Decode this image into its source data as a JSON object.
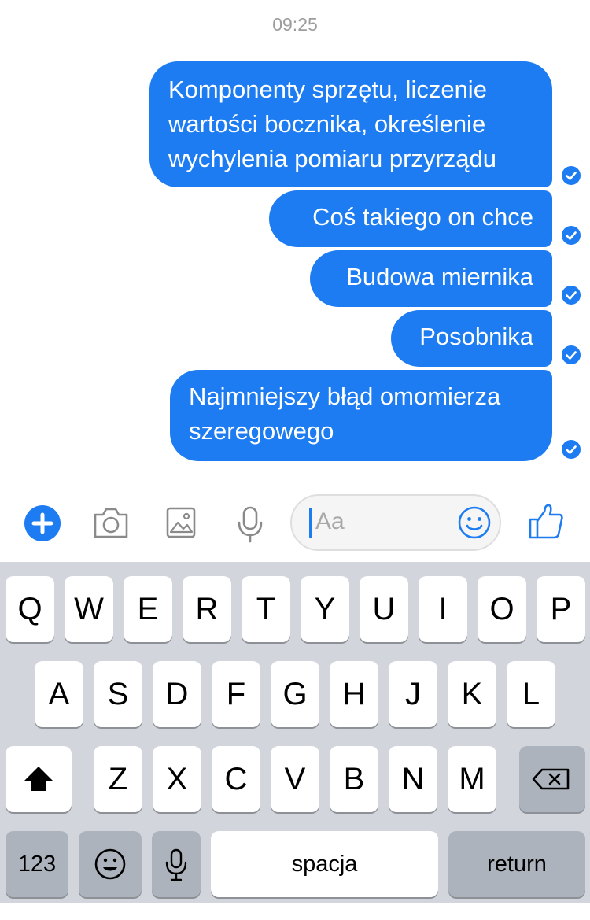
{
  "header": {
    "time": "09:25"
  },
  "messages": [
    {
      "lines": [
        "Komponenty sprzętu, liczenie",
        "wartości bocznika, określenie",
        "wychylenia pomiaru przyrządu"
      ]
    },
    {
      "lines": [
        "Coś takiego on chce"
      ]
    },
    {
      "lines": [
        "Budowa miernika"
      ]
    },
    {
      "lines": [
        "Posobnika"
      ]
    },
    {
      "lines": [
        "Najmniejszy błąd omomierza",
        "szeregowego"
      ]
    }
  ],
  "composer": {
    "placeholder": "Aa",
    "icons": [
      "plus-icon",
      "camera-icon",
      "image-icon",
      "microphone-icon",
      "emoji-icon",
      "thumbs-up-icon"
    ],
    "accent": "#1d7cf2"
  },
  "keyboard": {
    "row1": [
      "Q",
      "W",
      "E",
      "R",
      "T",
      "Y",
      "U",
      "I",
      "O",
      "P"
    ],
    "row2": [
      "A",
      "S",
      "D",
      "F",
      "G",
      "H",
      "J",
      "K",
      "L"
    ],
    "row3": [
      "Z",
      "X",
      "C",
      "V",
      "B",
      "N",
      "M"
    ],
    "numbers_label": "123",
    "space_label": "spacja",
    "return_label": "return"
  }
}
